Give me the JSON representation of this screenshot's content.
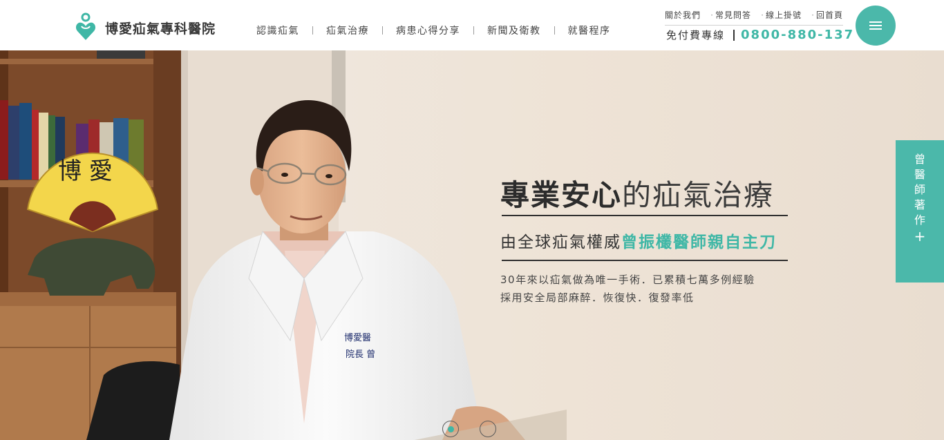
{
  "brand": {
    "name": "博愛疝氣專科醫院",
    "color": "#3fb7a6",
    "icon": "heart-person-logo-icon"
  },
  "nav": {
    "items": [
      {
        "label": "認識疝氣"
      },
      {
        "label": "疝氣治療"
      },
      {
        "label": "病患心得分享"
      },
      {
        "label": "新聞及衛教"
      },
      {
        "label": "就醫程序"
      }
    ]
  },
  "topbar": {
    "links": [
      {
        "label": "關於我們"
      },
      {
        "label": "常見問答"
      },
      {
        "label": "線上掛號"
      },
      {
        "label": "回首頁"
      }
    ],
    "hotline_label": "免付費專線",
    "hotline_number": "0800-880-137"
  },
  "menu_button": {
    "icon": "hamburger-menu-icon",
    "color": "#4bb8aa"
  },
  "hero": {
    "title_bold": "專業安心",
    "title_rest": "的疝氣治療",
    "subtitle_plain": "由全球疝氣權威",
    "subtitle_accent": "曾振欉醫師親自主刀",
    "line1": "30年來以疝氣做為唯一手術．已累積七萬多例經驗",
    "line2": "採用安全局部麻醉．恢復快．復發率低",
    "photo_fan_text": "博 愛",
    "photo_coat_text_1": "博愛醫",
    "photo_coat_text_2": "院長 曾"
  },
  "side_tab": {
    "chars": [
      "曾",
      "醫",
      "師",
      "著",
      "作",
      "+"
    ]
  },
  "carousel": {
    "count": 2,
    "active": 1
  }
}
